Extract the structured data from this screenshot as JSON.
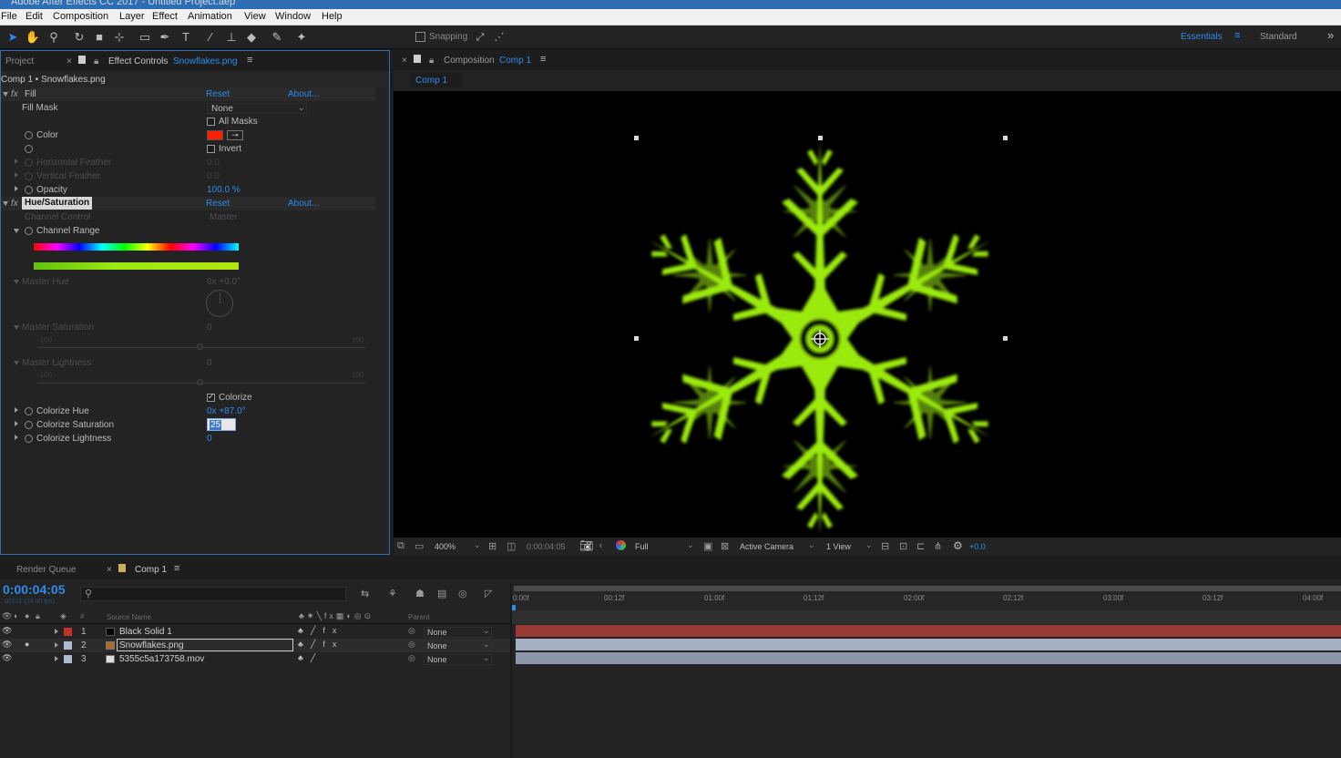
{
  "app": {
    "title": "Adobe After Effects CC 2017 - Untitled Project.aep"
  },
  "menu": [
    "File",
    "Edit",
    "Composition",
    "Layer",
    "Effect",
    "Animation",
    "View",
    "Window",
    "Help"
  ],
  "toolbar": {
    "snapping_label": "Snapping",
    "workspace_active": "Essentials",
    "workspace_other": "Standard",
    "overflow": "»"
  },
  "left_panel": {
    "tab_project": "Project",
    "tab_effect_controls_prefix": "Effect Controls",
    "tab_effect_controls_file": "Snowflakes.png",
    "breadcrumb": "Comp 1 • Snowflakes.png",
    "fill": {
      "name": "Fill",
      "reset": "Reset",
      "about": "About...",
      "fill_mask_label": "Fill Mask",
      "fill_mask_value": "None",
      "all_masks_label": "All Masks",
      "color_label": "Color",
      "color_value": "#ff1e00",
      "invert_label": "Invert",
      "h_feather_label": "Horizontal Feather",
      "h_feather_value": "0.0",
      "v_feather_label": "Vertical Feather",
      "v_feather_value": "0.0",
      "opacity_label": "Opacity",
      "opacity_value": "100.0 %"
    },
    "hue_sat": {
      "name": "Hue/Saturation",
      "reset": "Reset",
      "about": "About...",
      "channel_control_label": "Channel Control",
      "channel_control_value": "Master",
      "channel_range_label": "Channel Range",
      "master_hue_label": "Master Hue",
      "master_hue_value": "0x +0.0°",
      "master_sat_label": "Master Saturation",
      "master_sat_value": "0",
      "master_sat_min": "-100",
      "master_sat_max": "100",
      "master_light_label": "Master Lightness",
      "master_light_value": "0",
      "master_light_min": "-100",
      "master_light_max": "100",
      "colorize_label": "Colorize",
      "colorize_hue_label": "Colorize Hue",
      "colorize_hue_value": "0x +87.0°",
      "colorize_sat_label": "Colorize Saturation",
      "colorize_sat_value": "25",
      "colorize_light_label": "Colorize Lightness",
      "colorize_light_value": "0"
    }
  },
  "composition_panel": {
    "tab_prefix": "Composition",
    "tab_name": "Comp 1",
    "sub_tab": "Comp 1",
    "snowflake_color": "#9bea11",
    "footer": {
      "zoom": "400%",
      "timecode": "0:00:04:05",
      "resolution": "Full",
      "camera": "Active Camera",
      "views": "1 View",
      "exposure": "+0.0"
    }
  },
  "timeline": {
    "tab_render_queue": "Render Queue",
    "tab_comp": "Comp 1",
    "current_time": "0:00:04:05",
    "frame_info": "00101 (24.00 fps)",
    "columns": {
      "num": "#",
      "source": "Source Name",
      "parent": "Parent"
    },
    "layers": [
      {
        "num": "1",
        "name": "Black Solid 1",
        "label_color": "#c4312d",
        "parent": "None"
      },
      {
        "num": "2",
        "name": "Snowflakes.png",
        "label_color": "#aebbd0",
        "parent": "None"
      },
      {
        "num": "3",
        "name": "5355c5a173758.mov",
        "label_color": "#aebbd0",
        "parent": "None"
      }
    ],
    "ruler": [
      "0:00f",
      "00:12f",
      "01:00f",
      "01:12f",
      "02:00f",
      "02:12f",
      "03:00f",
      "03:12f",
      "04:00f"
    ]
  }
}
